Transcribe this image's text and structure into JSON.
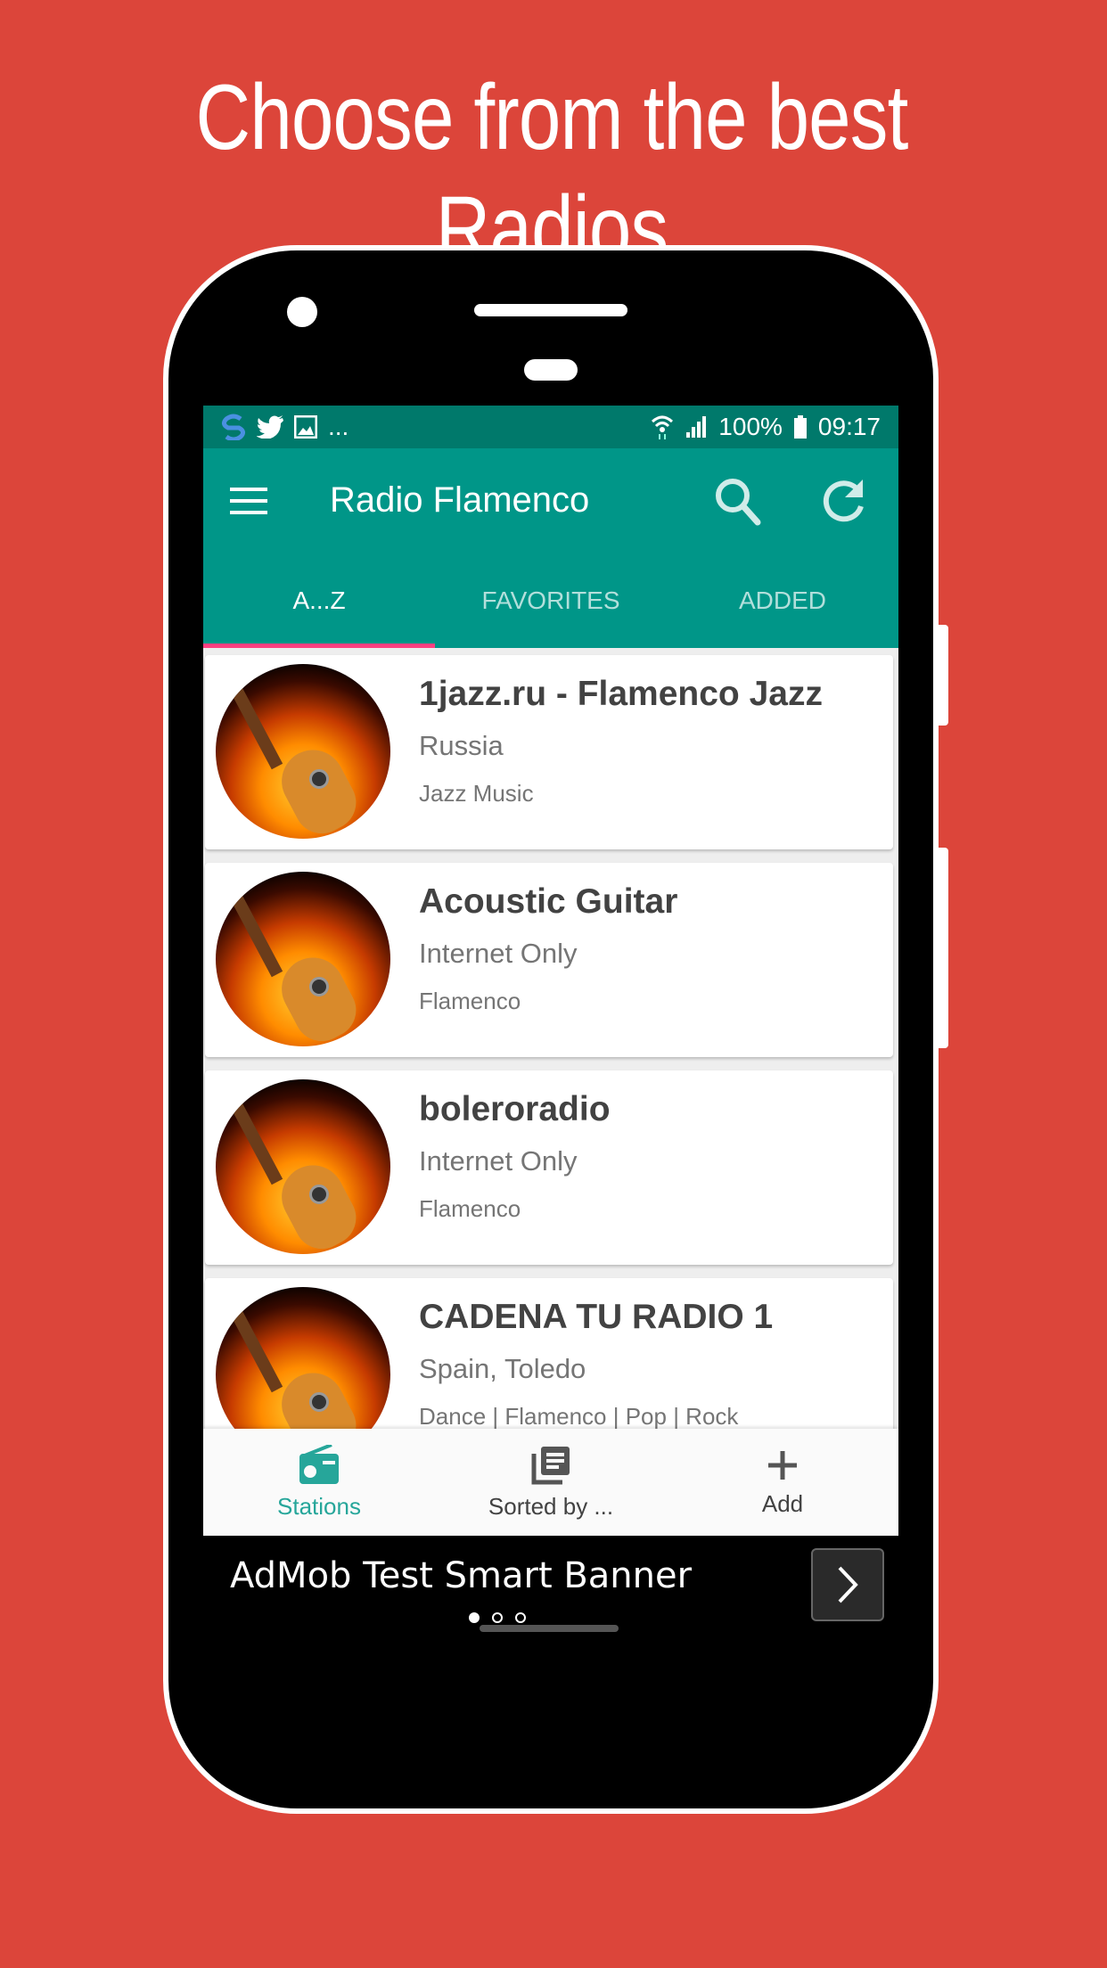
{
  "headline": "Choose from the best Radios",
  "statusbar": {
    "left_icons": [
      "sync-icon",
      "twitter-icon",
      "image-icon"
    ],
    "overflow": "...",
    "battery": "100%",
    "time": "09:17"
  },
  "toolbar": {
    "title": "Radio Flamenco",
    "icons": [
      "menu-icon",
      "search-icon",
      "refresh-icon"
    ]
  },
  "tabs": [
    {
      "label": "A...Z",
      "active": true
    },
    {
      "label": "FAVORITES",
      "active": false
    },
    {
      "label": "ADDED",
      "active": false
    }
  ],
  "stations": [
    {
      "name": "1jazz.ru - Flamenco Jazz",
      "location": "Russia",
      "genre": "Jazz Music"
    },
    {
      "name": "Acoustic Guitar",
      "location": "Internet Only",
      "genre": "Flamenco"
    },
    {
      "name": "boleroradio",
      "location": "Internet Only",
      "genre": "Flamenco"
    },
    {
      "name": "CADENA TU RADIO 1",
      "location": "Spain, Toledo",
      "genre": "Dance | Flamenco | Pop | Rock"
    }
  ],
  "bottom_nav": [
    {
      "label": "Stations",
      "icon": "radio-icon",
      "active": true
    },
    {
      "label": "Sorted by ...",
      "icon": "library-icon",
      "active": false
    },
    {
      "label": "Add",
      "icon": "plus-icon",
      "active": false
    }
  ],
  "ad": {
    "text": "AdMob Test Smart Banner",
    "pages": 3,
    "current_page": 1
  },
  "colors": {
    "background": "#dc453a",
    "primary": "#009688",
    "primary_dark": "#00796b",
    "accent": "#ff4081",
    "active_nav": "#26a69a"
  }
}
